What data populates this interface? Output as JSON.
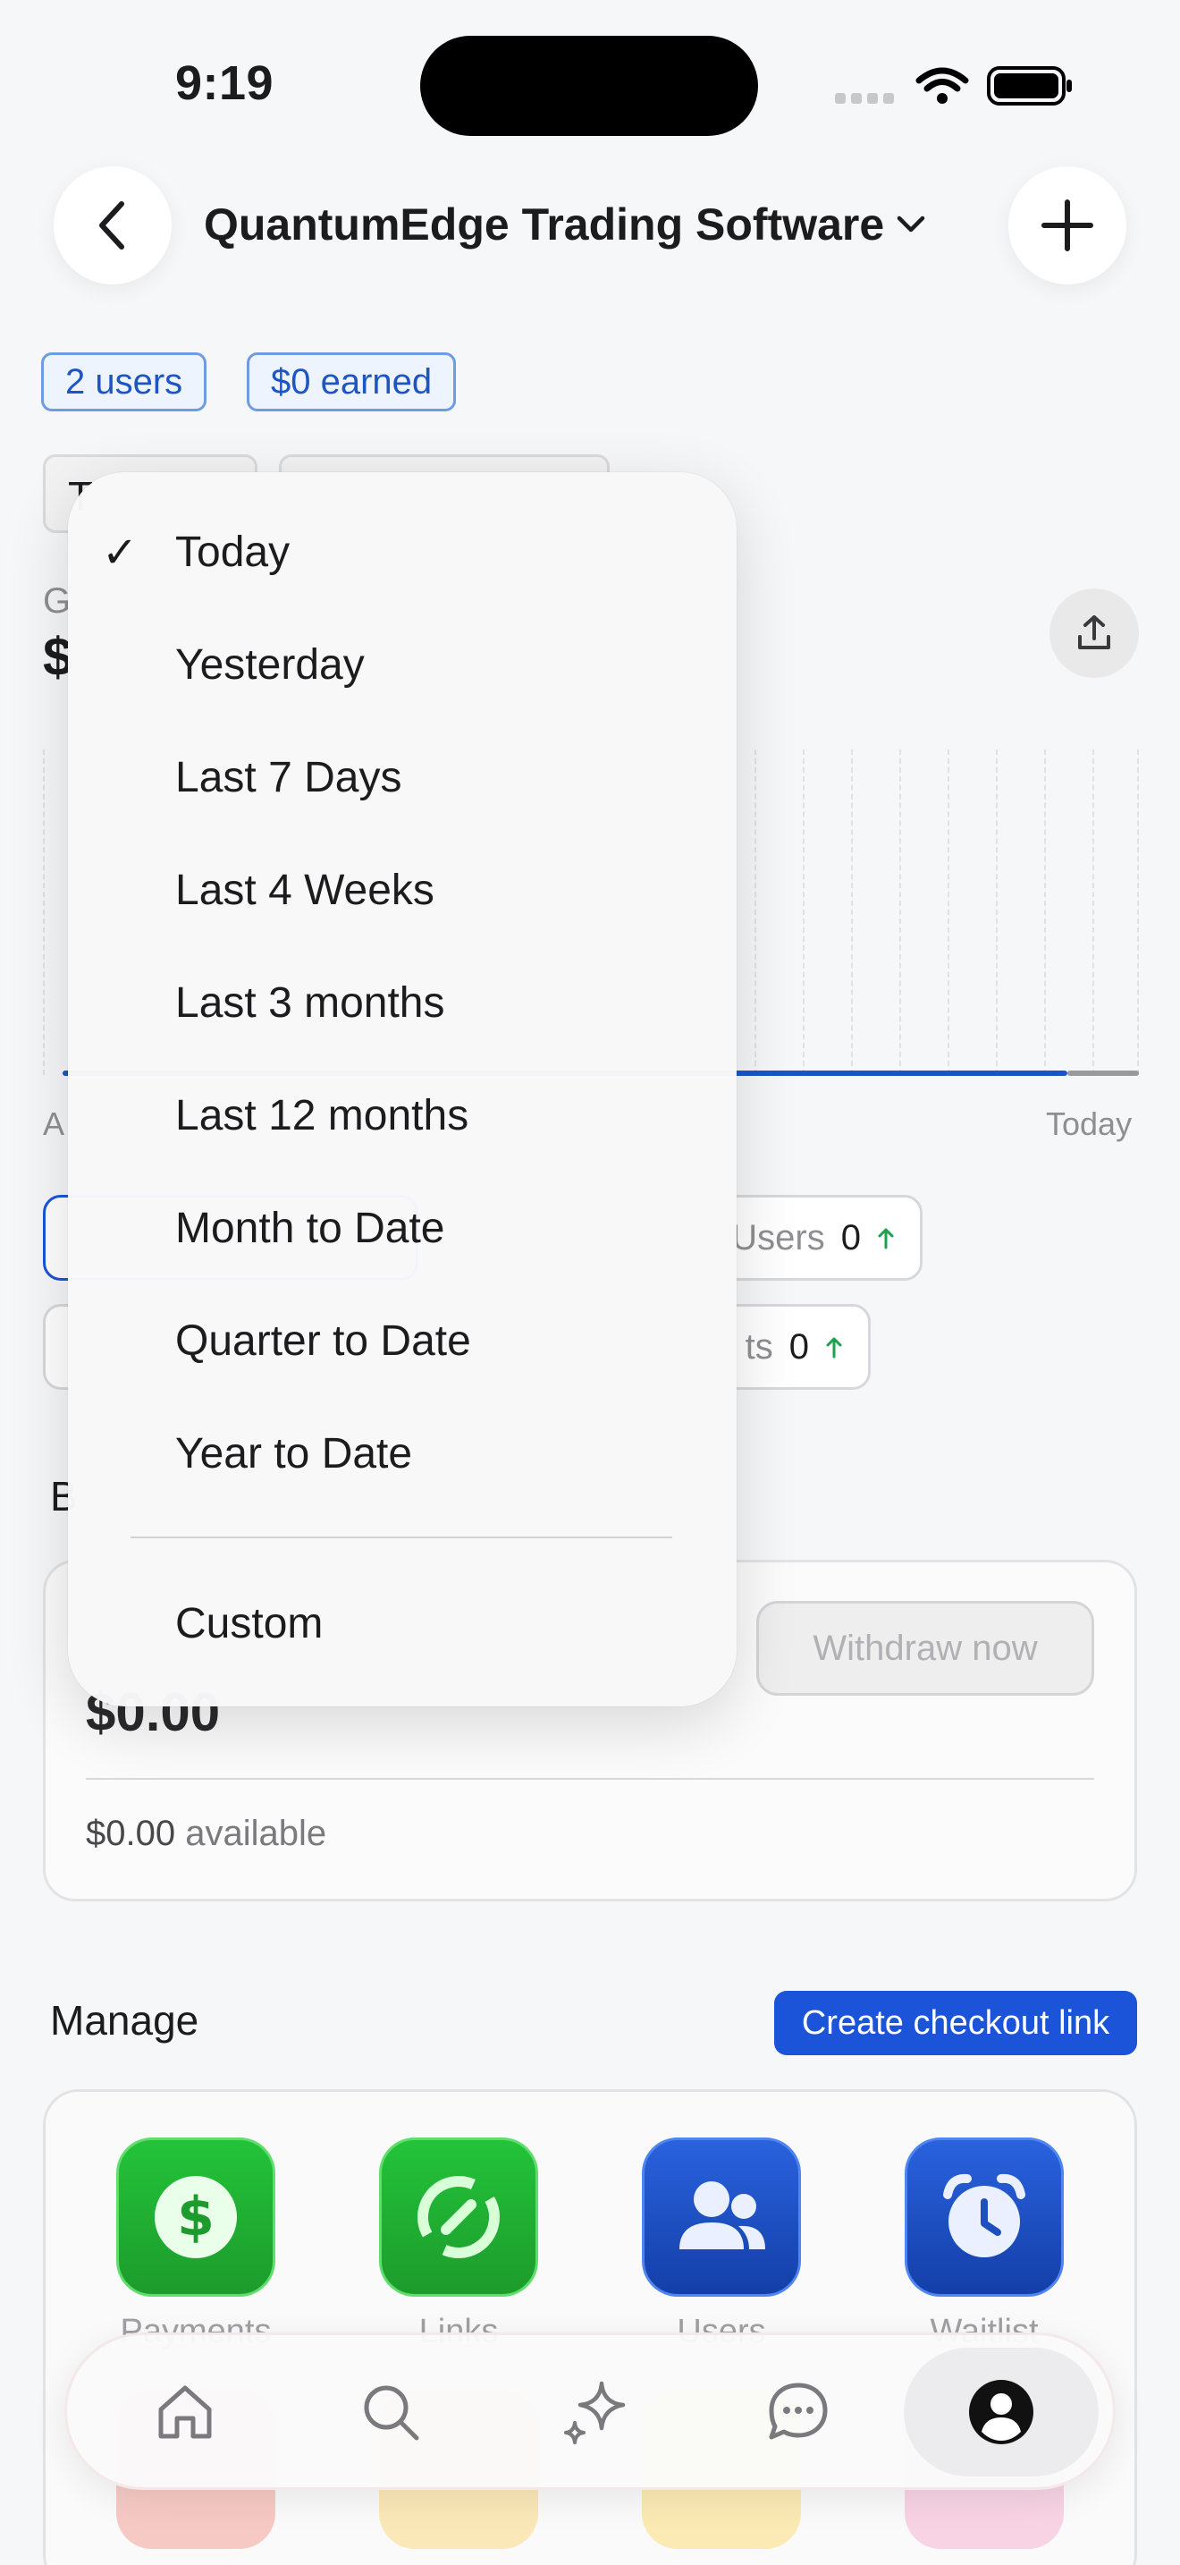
{
  "status_bar": {
    "time": "9:19"
  },
  "header": {
    "title": "QuantumEdge Trading Software"
  },
  "badges": {
    "users": "2 users",
    "earned": "$0 earned"
  },
  "background": {
    "filter_label_fragment": "T",
    "gross_label_fragment": "G",
    "gross_amount_fragment": "$",
    "axis_left_fragment": "A",
    "axis_right": "Today",
    "stats": [
      {
        "label": "Users",
        "value": "0"
      },
      {
        "label": "ts",
        "value": "0"
      }
    ]
  },
  "balance": {
    "section_fragment": "B",
    "withdraw_label": "Withdraw now",
    "amount": "$0.00",
    "available_amount": "$0.00",
    "available_label": "available"
  },
  "manage": {
    "title": "Manage",
    "checkout_label": "Create checkout link",
    "apps": [
      {
        "label": "Payments",
        "icon": "dollar-icon"
      },
      {
        "label": "Links",
        "icon": "link-icon"
      },
      {
        "label": "Users",
        "icon": "users-icon"
      },
      {
        "label": "Waitlist",
        "icon": "alarm-clock-icon"
      }
    ]
  },
  "dropdown": {
    "selected": "Today",
    "items": [
      "Today",
      "Yesterday",
      "Last 7 Days",
      "Last 4 Weeks",
      "Last 3 months",
      "Last 12 months",
      "Month to Date",
      "Quarter to Date",
      "Year to Date"
    ],
    "custom": "Custom"
  },
  "tabbar": {
    "tabs": [
      "home-icon",
      "search-icon",
      "sparkle-icon",
      "chat-icon",
      "profile-icon"
    ]
  },
  "colors": {
    "accent": "#1b54d8",
    "badge_border": "#6f9be0",
    "green": "#1d9b2c",
    "stat_up": "#1aa34a"
  }
}
